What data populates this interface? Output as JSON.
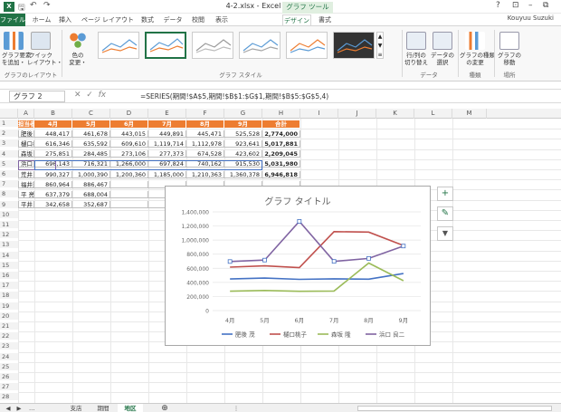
{
  "window": {
    "title": "4-2.xlsx - Excel",
    "chart_tools": "グラフ ツール",
    "help": "?",
    "user": "Kouyuu Suzuki"
  },
  "tabs": [
    "ファイル",
    "ホーム",
    "挿入",
    "ページ レイアウト",
    "数式",
    "データ",
    "校閲",
    "表示",
    "デザイン",
    "書式"
  ],
  "ribbon": {
    "add_element": "グラフ要素\nを追加・",
    "quick_layout": "クイック\nレイアウト・",
    "change_color": "色の\n変更・",
    "group_layouts": "グラフのレイアウト",
    "group_styles": "グラフ スタイル",
    "switch_rowcol": "行/列の\n切り替え",
    "select_data": "データの\n選択",
    "group_data": "データ",
    "change_type": "グラフの種類\nの変更",
    "group_type": "種類",
    "move_chart": "グラフの\n移動",
    "group_location": "場所"
  },
  "formula_bar": {
    "name_box": "グラフ 2",
    "fx": "fx",
    "formula": "=SERIES(期間!$A$5,期間!$B$1:$G$1,期間!$B$5:$G$5,4)"
  },
  "columns": [
    "A",
    "B",
    "C",
    "D",
    "E",
    "F",
    "G",
    "H",
    "I",
    "J",
    "K",
    "L",
    "M"
  ],
  "rows": [
    "1",
    "2",
    "3",
    "4",
    "5",
    "6",
    "7",
    "8",
    "9",
    "10",
    "11",
    "12",
    "13",
    "14",
    "15",
    "16",
    "17",
    "18",
    "19",
    "20",
    "21",
    "22",
    "23",
    "24",
    "25",
    "26",
    "27",
    "28"
  ],
  "table": {
    "headers": [
      "担当者名",
      "4月",
      "5月",
      "6月",
      "7月",
      "8月",
      "9月",
      "合計"
    ],
    "data": [
      [
        "肥後 茂",
        "448,417",
        "461,678",
        "443,015",
        "449,891",
        "445,471",
        "525,528",
        "2,774,000"
      ],
      [
        "樋口桃子",
        "616,346",
        "635,592",
        "609,610",
        "1,119,714",
        "1,112,978",
        "923,641",
        "5,017,881"
      ],
      [
        "森坂 隆",
        "275,851",
        "284,485",
        "273,106",
        "277,373",
        "674,528",
        "423,602",
        "2,209,045"
      ],
      [
        "浜口 良二",
        "696,143",
        "716,321",
        "1,266,000",
        "697,824",
        "740,162",
        "915,530",
        "5,031,980"
      ],
      [
        "荒井 博文",
        "990,327",
        "1,000,390",
        "1,200,360",
        "1,185,000",
        "1,210,363",
        "1,360,378",
        "6,946,818"
      ],
      [
        "福井亜利",
        "860,964",
        "886,467",
        "",
        "",
        "",
        "",
        ""
      ],
      [
        "平 亮昭",
        "637,379",
        "688,004",
        "",
        "",
        "",
        "",
        ""
      ],
      [
        "平井 康康",
        "342,658",
        "352,687",
        "",
        "",
        "",
        "",
        ""
      ]
    ]
  },
  "chart_data": {
    "type": "line",
    "title": "グラフ タイトル",
    "categories": [
      "4月",
      "5月",
      "6月",
      "7月",
      "8月",
      "9月"
    ],
    "ylim": [
      0,
      1400000
    ],
    "yticks": [
      "0",
      "200,000",
      "400,000",
      "600,000",
      "800,000",
      "1,000,000",
      "1,200,000",
      "1,400,000"
    ],
    "ytick_values": [
      0,
      200000,
      400000,
      600000,
      800000,
      1000000,
      1200000,
      1400000
    ],
    "legend_position": "bottom",
    "selected_series": "浜口 良二",
    "series": [
      {
        "name": "肥後 茂",
        "color": "#4472c4",
        "values": [
          448417,
          461678,
          443015,
          449891,
          445471,
          525528
        ]
      },
      {
        "name": "樋口桃子",
        "color": "#c0504d",
        "values": [
          616346,
          635592,
          609610,
          1119714,
          1112978,
          923641
        ]
      },
      {
        "name": "森坂 隆",
        "color": "#9bbb59",
        "values": [
          275851,
          284485,
          273106,
          277373,
          674528,
          423602
        ]
      },
      {
        "name": "浜口 良二",
        "color": "#8064a2",
        "values": [
          696143,
          716321,
          1266000,
          697824,
          740162,
          915530
        ]
      }
    ]
  },
  "sheet_tabs": [
    "支店",
    "期間",
    "地区"
  ],
  "active_sheet": "地区",
  "icons": {
    "plus": "+",
    "brush": "✎",
    "filter": "▼"
  }
}
